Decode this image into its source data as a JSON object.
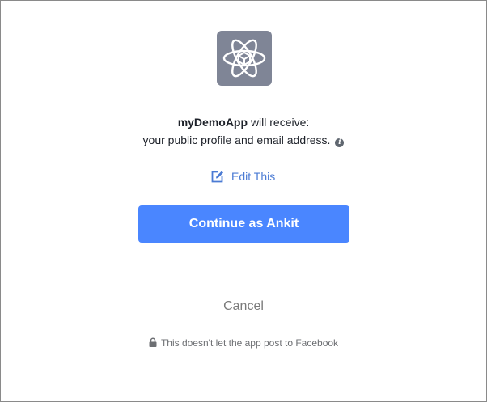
{
  "app": {
    "name": "myDemoApp",
    "icon": "atom-cube-icon"
  },
  "permission": {
    "receive_text": "will receive:",
    "details": "your public profile and email address.",
    "info_icon": "info-icon"
  },
  "edit": {
    "label": "Edit This",
    "icon": "edit-pencil-icon"
  },
  "continue_button": {
    "label": "Continue as Ankit"
  },
  "cancel_button": {
    "label": "Cancel"
  },
  "footer": {
    "note": "This doesn't let the app post to Facebook",
    "icon": "lock-icon"
  },
  "colors": {
    "primary": "#4a86ff",
    "link": "#4b7bd4",
    "app_icon_bg": "#7f8596",
    "text": "#1d2129",
    "muted": "#7a7a7a"
  }
}
